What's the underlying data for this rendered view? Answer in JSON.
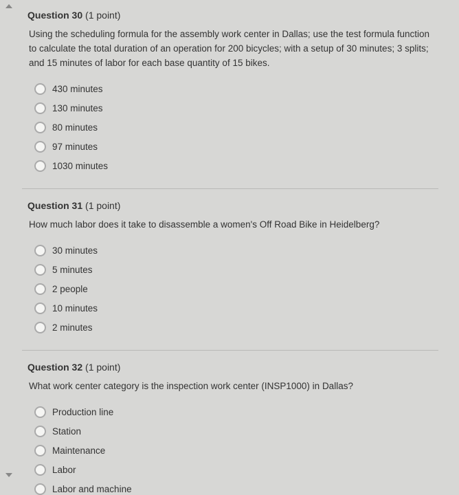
{
  "questions": [
    {
      "number": "Question 30",
      "points": "(1 point)",
      "text": "Using the scheduling formula for the assembly work center in Dallas; use the test formula function to calculate the total duration of an operation for 200 bicycles; with a setup of 30 minutes; 3 splits; and 15 minutes of labor for each base quantity of 15 bikes.",
      "options": [
        "430 minutes",
        "130 minutes",
        "80 minutes",
        "97 minutes",
        "1030 minutes"
      ]
    },
    {
      "number": "Question 31",
      "points": "(1 point)",
      "text": "How much labor does it take to disassemble a women's Off Road Bike in Heidelberg?",
      "options": [
        "30 minutes",
        "5 minutes",
        "2 people",
        "10 minutes",
        "2 minutes"
      ]
    },
    {
      "number": "Question 32",
      "points": "(1 point)",
      "text": "What work center category is the inspection work center (INSP1000) in Dallas?",
      "options": [
        "Production line",
        "Station",
        "Maintenance",
        "Labor",
        "Labor and machine"
      ]
    }
  ]
}
